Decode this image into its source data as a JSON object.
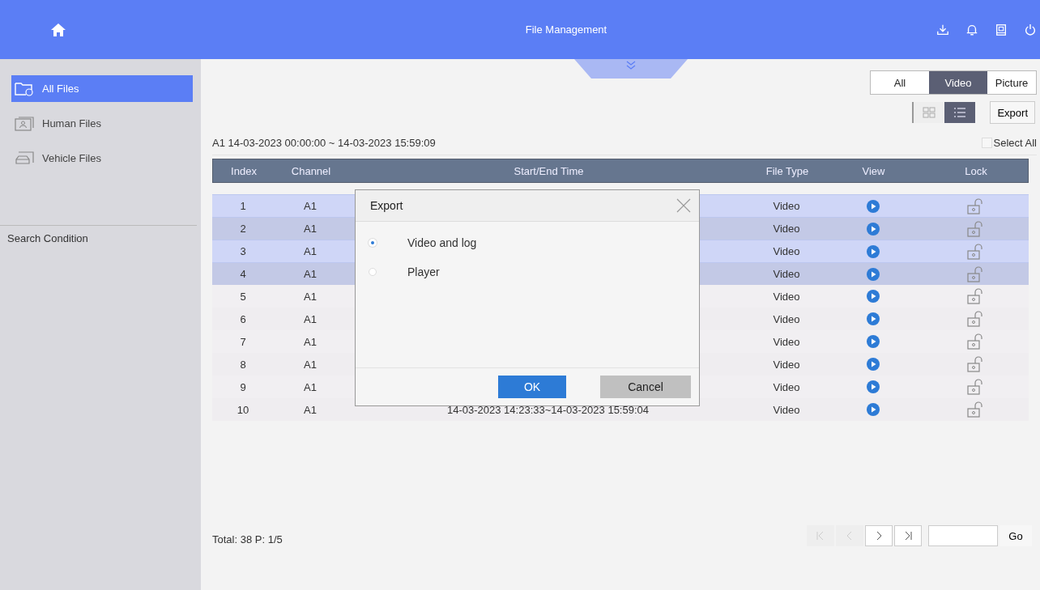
{
  "header": {
    "title": "File Management"
  },
  "sidebar": {
    "items": [
      {
        "label": "All Files",
        "selected": true,
        "kind": "all"
      },
      {
        "label": "Human Files",
        "selected": false,
        "kind": "human"
      },
      {
        "label": "Vehicle Files",
        "selected": false,
        "kind": "vehicle"
      }
    ],
    "section": "Search Condition"
  },
  "filter_tabs": [
    {
      "label": "All",
      "selected": false
    },
    {
      "label": "Video",
      "selected": true
    },
    {
      "label": "Picture",
      "selected": false
    }
  ],
  "view_modes": [
    {
      "kind": "grid",
      "selected": false
    },
    {
      "kind": "list",
      "selected": true
    }
  ],
  "export_button": "Export",
  "range": "A1 14-03-2023 00:00:00 ~ 14-03-2023 15:59:09",
  "select_all": {
    "label": "Select All",
    "checked": false
  },
  "table": {
    "columns": [
      "Index",
      "Channel",
      "Start/End Time",
      "File Type",
      "View",
      "Lock"
    ],
    "rows": [
      {
        "index": "1",
        "channel": "A1",
        "type": "Video",
        "selected": true
      },
      {
        "index": "2",
        "channel": "A1",
        "type": "Video",
        "selected": true
      },
      {
        "index": "3",
        "channel": "A1",
        "type": "Video",
        "selected": true
      },
      {
        "index": "4",
        "channel": "A1",
        "type": "Video",
        "selected": true
      },
      {
        "index": "5",
        "channel": "A1",
        "type": "Video",
        "selected": false
      },
      {
        "index": "6",
        "channel": "A1",
        "type": "Video",
        "selected": false
      },
      {
        "index": "7",
        "channel": "A1",
        "type": "Video",
        "selected": false
      },
      {
        "index": "8",
        "channel": "A1",
        "type": "Video",
        "selected": false
      },
      {
        "index": "9",
        "channel": "A1",
        "type": "Video",
        "selected": false
      },
      {
        "index": "10",
        "channel": "A1",
        "time": "14-03-2023 14:23:33~14-03-2023 15:59:04",
        "type": "Video",
        "selected": false
      }
    ]
  },
  "footer": {
    "total": "Total: 38  P: 1/5",
    "pager": [
      {
        "kind": "first",
        "disabled": true
      },
      {
        "kind": "prev",
        "disabled": true
      },
      {
        "kind": "next",
        "disabled": false
      },
      {
        "kind": "last",
        "disabled": false
      }
    ],
    "go": "Go"
  },
  "dialog": {
    "title": "Export",
    "options": [
      {
        "label": "Video and log",
        "selected": true
      },
      {
        "label": "Player",
        "selected": false
      }
    ],
    "ok": "OK",
    "cancel": "Cancel"
  }
}
